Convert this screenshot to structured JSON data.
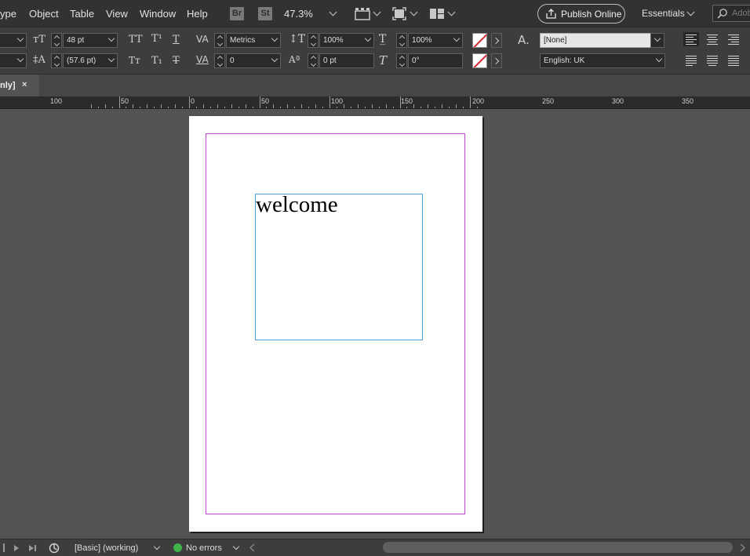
{
  "menubar": {
    "items": [
      "ype",
      "Object",
      "Table",
      "View",
      "Window",
      "Help"
    ],
    "bridge_badge": "Br",
    "stock_badge": "St",
    "zoom": "47.3%",
    "publish_label": "Publish Online",
    "workspace": "Essentials",
    "search_placeholder": "Adob"
  },
  "control_panel": {
    "font_size": "48 pt",
    "leading": "(57.6 pt)",
    "kerning": "Metrics",
    "tracking": "0",
    "vertical_scale": "100%",
    "horizontal_scale": "100%",
    "baseline_shift": "0 pt",
    "skew": "0°",
    "char_style": "[None]",
    "language": "English: UK"
  },
  "tab": {
    "title": "nly]",
    "close": "×"
  },
  "ruler": {
    "labels": [
      "100",
      "50",
      "0",
      "50",
      "100",
      "150",
      "200",
      "250",
      "300",
      "350"
    ]
  },
  "document": {
    "text": "welcome"
  },
  "statusbar": {
    "profile": "[Basic] (working)",
    "errors": "No errors"
  },
  "colors": {
    "margin_guide": "#c246d4",
    "frame_border": "#4ea0d6",
    "status_ok": "#40b24a"
  }
}
